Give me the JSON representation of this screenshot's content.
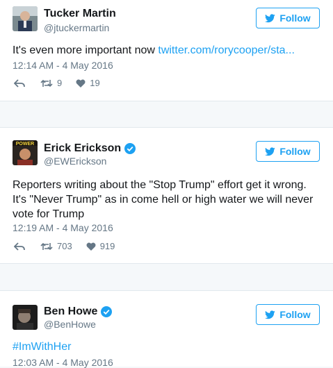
{
  "follow_label": "Follow",
  "colors": {
    "accent": "#1da1f2",
    "muted": "#657786",
    "text": "#14171a"
  },
  "tweets": [
    {
      "name": "Tucker Martin",
      "handle": "@jtuckermartin",
      "verified": false,
      "text": "It's even more important now ",
      "link": "twitter.com/rorycooper/sta...",
      "timestamp": "12:14 AM - 4 May 2016",
      "retweets": "9",
      "likes": "19"
    },
    {
      "name": "Erick Erickson",
      "handle": "@EWErickson",
      "verified": true,
      "avatar_text": "POWER",
      "text": "Reporters writing about the \"Stop Trump\" effort get it wrong. It's \"Never Trump\" as in come hell or high water we will never vote for Trump",
      "timestamp": "12:19 AM - 4 May 2016",
      "retweets": "703",
      "likes": "919"
    },
    {
      "name": "Ben Howe",
      "handle": "@BenHowe",
      "verified": true,
      "hashtag": "#ImWithHer",
      "timestamp": "12:03 AM - 4 May 2016"
    }
  ]
}
